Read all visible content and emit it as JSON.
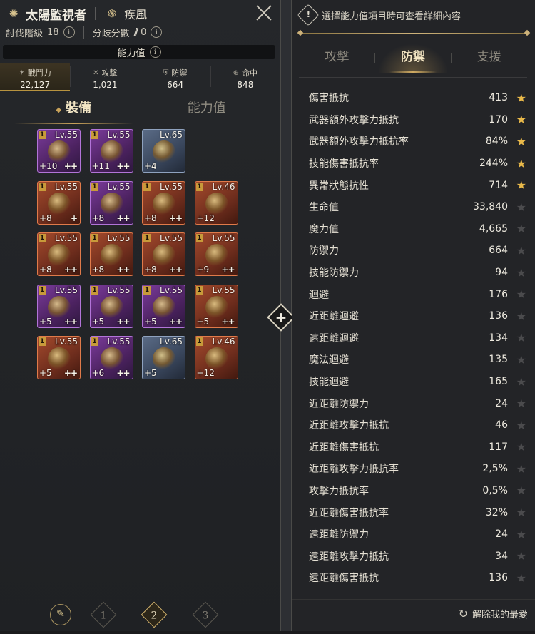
{
  "header": {
    "title": "太陽監視者",
    "class_name": "疾風",
    "subjugation_label": "討伐階級",
    "subjugation_value": "18",
    "branch_label": "分歧分數",
    "branch_value": "0"
  },
  "stats_bar": {
    "label": "能力值"
  },
  "summary": [
    {
      "label": "戰鬥力",
      "value": "22,127",
      "icon": "crossed-swords-icon"
    },
    {
      "label": "攻擊",
      "value": "1,021",
      "icon": "sword-icon"
    },
    {
      "label": "防禦",
      "value": "664",
      "icon": "shield-icon"
    },
    {
      "label": "命中",
      "value": "848",
      "icon": "crosshair-icon"
    }
  ],
  "left_tabs": [
    {
      "label": "裝備",
      "active": true
    },
    {
      "label": "能力值",
      "active": false
    }
  ],
  "gear": [
    {
      "tier": "1",
      "lv": "Lv.55",
      "up": "+10",
      "pp": "++",
      "grade": "epic"
    },
    {
      "tier": "1",
      "lv": "Lv.55",
      "up": "+11",
      "pp": "++",
      "grade": "epic"
    },
    {
      "tier": "",
      "lv": "Lv.65",
      "up": "+4",
      "pp": "",
      "grade": "ancient"
    },
    null,
    {
      "tier": "1",
      "lv": "Lv.55",
      "up": "+8",
      "pp": "+",
      "grade": "relic"
    },
    {
      "tier": "1",
      "lv": "Lv.55",
      "up": "+8",
      "pp": "++",
      "grade": "epic"
    },
    {
      "tier": "1",
      "lv": "Lv.55",
      "up": "+8",
      "pp": "++",
      "grade": "relic"
    },
    {
      "tier": "1",
      "lv": "Lv.46",
      "up": "+12",
      "pp": "",
      "grade": "relic"
    },
    {
      "tier": "1",
      "lv": "Lv.55",
      "up": "+8",
      "pp": "++",
      "grade": "relic"
    },
    {
      "tier": "1",
      "lv": "Lv.55",
      "up": "+8",
      "pp": "++",
      "grade": "relic"
    },
    {
      "tier": "1",
      "lv": "Lv.55",
      "up": "+8",
      "pp": "++",
      "grade": "relic"
    },
    {
      "tier": "1",
      "lv": "Lv.55",
      "up": "+9",
      "pp": "++",
      "grade": "relic"
    },
    {
      "tier": "1",
      "lv": "Lv.55",
      "up": "+5",
      "pp": "++",
      "grade": "epic"
    },
    {
      "tier": "1",
      "lv": "Lv.55",
      "up": "+5",
      "pp": "++",
      "grade": "epic"
    },
    {
      "tier": "1",
      "lv": "Lv.55",
      "up": "+5",
      "pp": "++",
      "grade": "epic"
    },
    {
      "tier": "1",
      "lv": "Lv.55",
      "up": "+5",
      "pp": "++",
      "grade": "relic"
    },
    {
      "tier": "1",
      "lv": "Lv.55",
      "up": "+5",
      "pp": "++",
      "grade": "relic"
    },
    {
      "tier": "1",
      "lv": "Lv.55",
      "up": "+6",
      "pp": "++",
      "grade": "epic"
    },
    {
      "tier": "",
      "lv": "Lv.65",
      "up": "+5",
      "pp": "",
      "grade": "ancient"
    },
    {
      "tier": "1",
      "lv": "Lv.46",
      "up": "+12",
      "pp": "",
      "grade": "relic"
    }
  ],
  "pages": [
    "1",
    "2",
    "3"
  ],
  "active_page": "2",
  "right": {
    "hint": "選擇能力值項目時可查看詳細內容",
    "tabs": [
      {
        "label": "攻擊",
        "active": false
      },
      {
        "label": "防禦",
        "active": true
      },
      {
        "label": "支援",
        "active": false
      }
    ],
    "stats": [
      {
        "name": "傷害抵抗",
        "value": "413",
        "fav": true
      },
      {
        "name": "武器額外攻擊力抵抗",
        "value": "170",
        "fav": true
      },
      {
        "name": "武器額外攻擊力抵抗率",
        "value": "84%",
        "fav": true
      },
      {
        "name": "技能傷害抵抗率",
        "value": "244%",
        "fav": true
      },
      {
        "name": "異常狀態抗性",
        "value": "714",
        "fav": true
      },
      {
        "name": "生命值",
        "value": "33,840",
        "fav": false
      },
      {
        "name": "魔力值",
        "value": "4,665",
        "fav": false
      },
      {
        "name": "防禦力",
        "value": "664",
        "fav": false
      },
      {
        "name": "技能防禦力",
        "value": "94",
        "fav": false
      },
      {
        "name": "迴避",
        "value": "176",
        "fav": false
      },
      {
        "name": "近距離迴避",
        "value": "136",
        "fav": false
      },
      {
        "name": "遠距離迴避",
        "value": "134",
        "fav": false
      },
      {
        "name": "魔法迴避",
        "value": "135",
        "fav": false
      },
      {
        "name": "技能迴避",
        "value": "165",
        "fav": false
      },
      {
        "name": "近距離防禦力",
        "value": "24",
        "fav": false
      },
      {
        "name": "近距離攻擊力抵抗",
        "value": "46",
        "fav": false
      },
      {
        "name": "近距離傷害抵抗",
        "value": "117",
        "fav": false
      },
      {
        "name": "近距離攻擊力抵抗率",
        "value": "2,5%",
        "fav": false
      },
      {
        "name": "攻擊力抵抗率",
        "value": "0,5%",
        "fav": false
      },
      {
        "name": "近距離傷害抵抗率",
        "value": "32%",
        "fav": false
      },
      {
        "name": "遠距離防禦力",
        "value": "24",
        "fav": false
      },
      {
        "name": "遠距離攻擊力抵抗",
        "value": "34",
        "fav": false
      },
      {
        "name": "遠距離傷害抵抗",
        "value": "136",
        "fav": false
      }
    ],
    "footer_button": "解除我的最愛"
  },
  "colors": {
    "accent": "#d0ab62",
    "star_on": "#e9b94a",
    "star_off": "#4b4b4d"
  }
}
